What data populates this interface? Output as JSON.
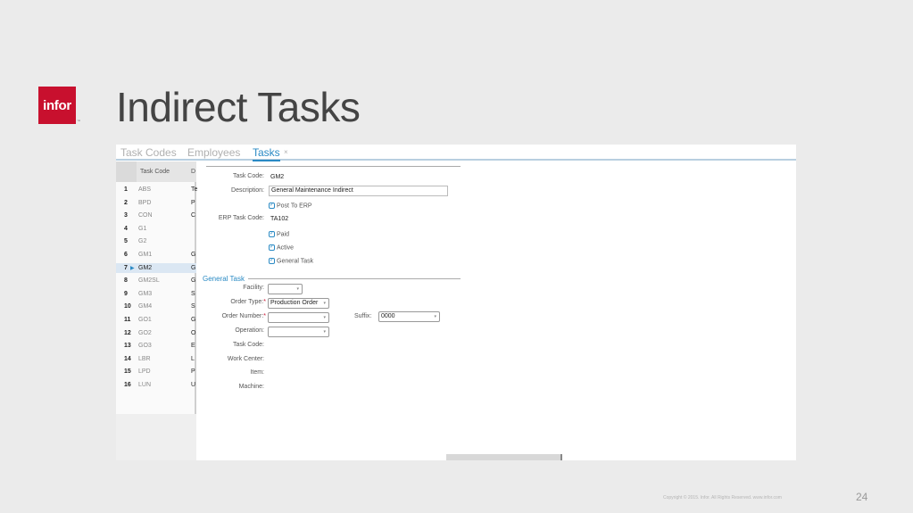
{
  "slide": {
    "title": "Indirect Tasks",
    "logo_text": "infor",
    "logo_tm": "™",
    "page_number": "24",
    "copyright": "Copyright © 2015. Infor. All Rights Reserved. www.infor.com"
  },
  "tabs": [
    {
      "label": "Task Codes",
      "active": false
    },
    {
      "label": "Employees",
      "active": false
    },
    {
      "label": "Tasks",
      "active": true
    }
  ],
  "tab_close": "×",
  "grid": {
    "headers": [
      "Task Code",
      "D"
    ],
    "rows": [
      {
        "num": "1",
        "code": "ABS",
        "d": "Te"
      },
      {
        "num": "2",
        "code": "BPD",
        "d": "P"
      },
      {
        "num": "3",
        "code": "CON",
        "d": "C"
      },
      {
        "num": "4",
        "code": "G1",
        "d": ""
      },
      {
        "num": "5",
        "code": "G2",
        "d": ""
      },
      {
        "num": "6",
        "code": "GM1",
        "d": "G"
      },
      {
        "num": "7",
        "code": "GM2",
        "d": "G",
        "selected": true
      },
      {
        "num": "8",
        "code": "GM2SL",
        "d": "G"
      },
      {
        "num": "9",
        "code": "GM3",
        "d": "S"
      },
      {
        "num": "10",
        "code": "GM4",
        "d": "S"
      },
      {
        "num": "11",
        "code": "GO1",
        "d": "G"
      },
      {
        "num": "12",
        "code": "GO2",
        "d": "O"
      },
      {
        "num": "13",
        "code": "GO3",
        "d": "E"
      },
      {
        "num": "14",
        "code": "LBR",
        "d": "L"
      },
      {
        "num": "15",
        "code": "LPD",
        "d": "P"
      },
      {
        "num": "16",
        "code": "LUN",
        "d": "U"
      }
    ],
    "scroll_left": "◂ ▯",
    "scroll_right": "▸"
  },
  "form": {
    "task_code_label": "Task Code:",
    "task_code_value": "GM2",
    "description_label": "Description:",
    "description_value": "General Maintenance Indirect",
    "post_to_erp": "Post To ERP",
    "erp_task_code_label": "ERP Task Code:",
    "erp_task_code_value": "TA102",
    "paid": "Paid",
    "active": "Active",
    "general_task_chk": "General Task",
    "section_title": "General Task",
    "facility_label": "Facility:",
    "facility_value": "",
    "order_type_label": "Order Type:",
    "order_type_value": "Production Order",
    "order_number_label": "Order Number:",
    "order_number_value": "",
    "suffix_label": "Suffix:",
    "suffix_value": "0000",
    "operation_label": "Operation:",
    "operation_value": "",
    "task_code2_label": "Task Code:",
    "work_center_label": "Work Center:",
    "item_label": "Item:",
    "machine_label": "Machine:",
    "required_mark": "*",
    "check_mark": "✓",
    "dropdown_arrow": "▾"
  }
}
